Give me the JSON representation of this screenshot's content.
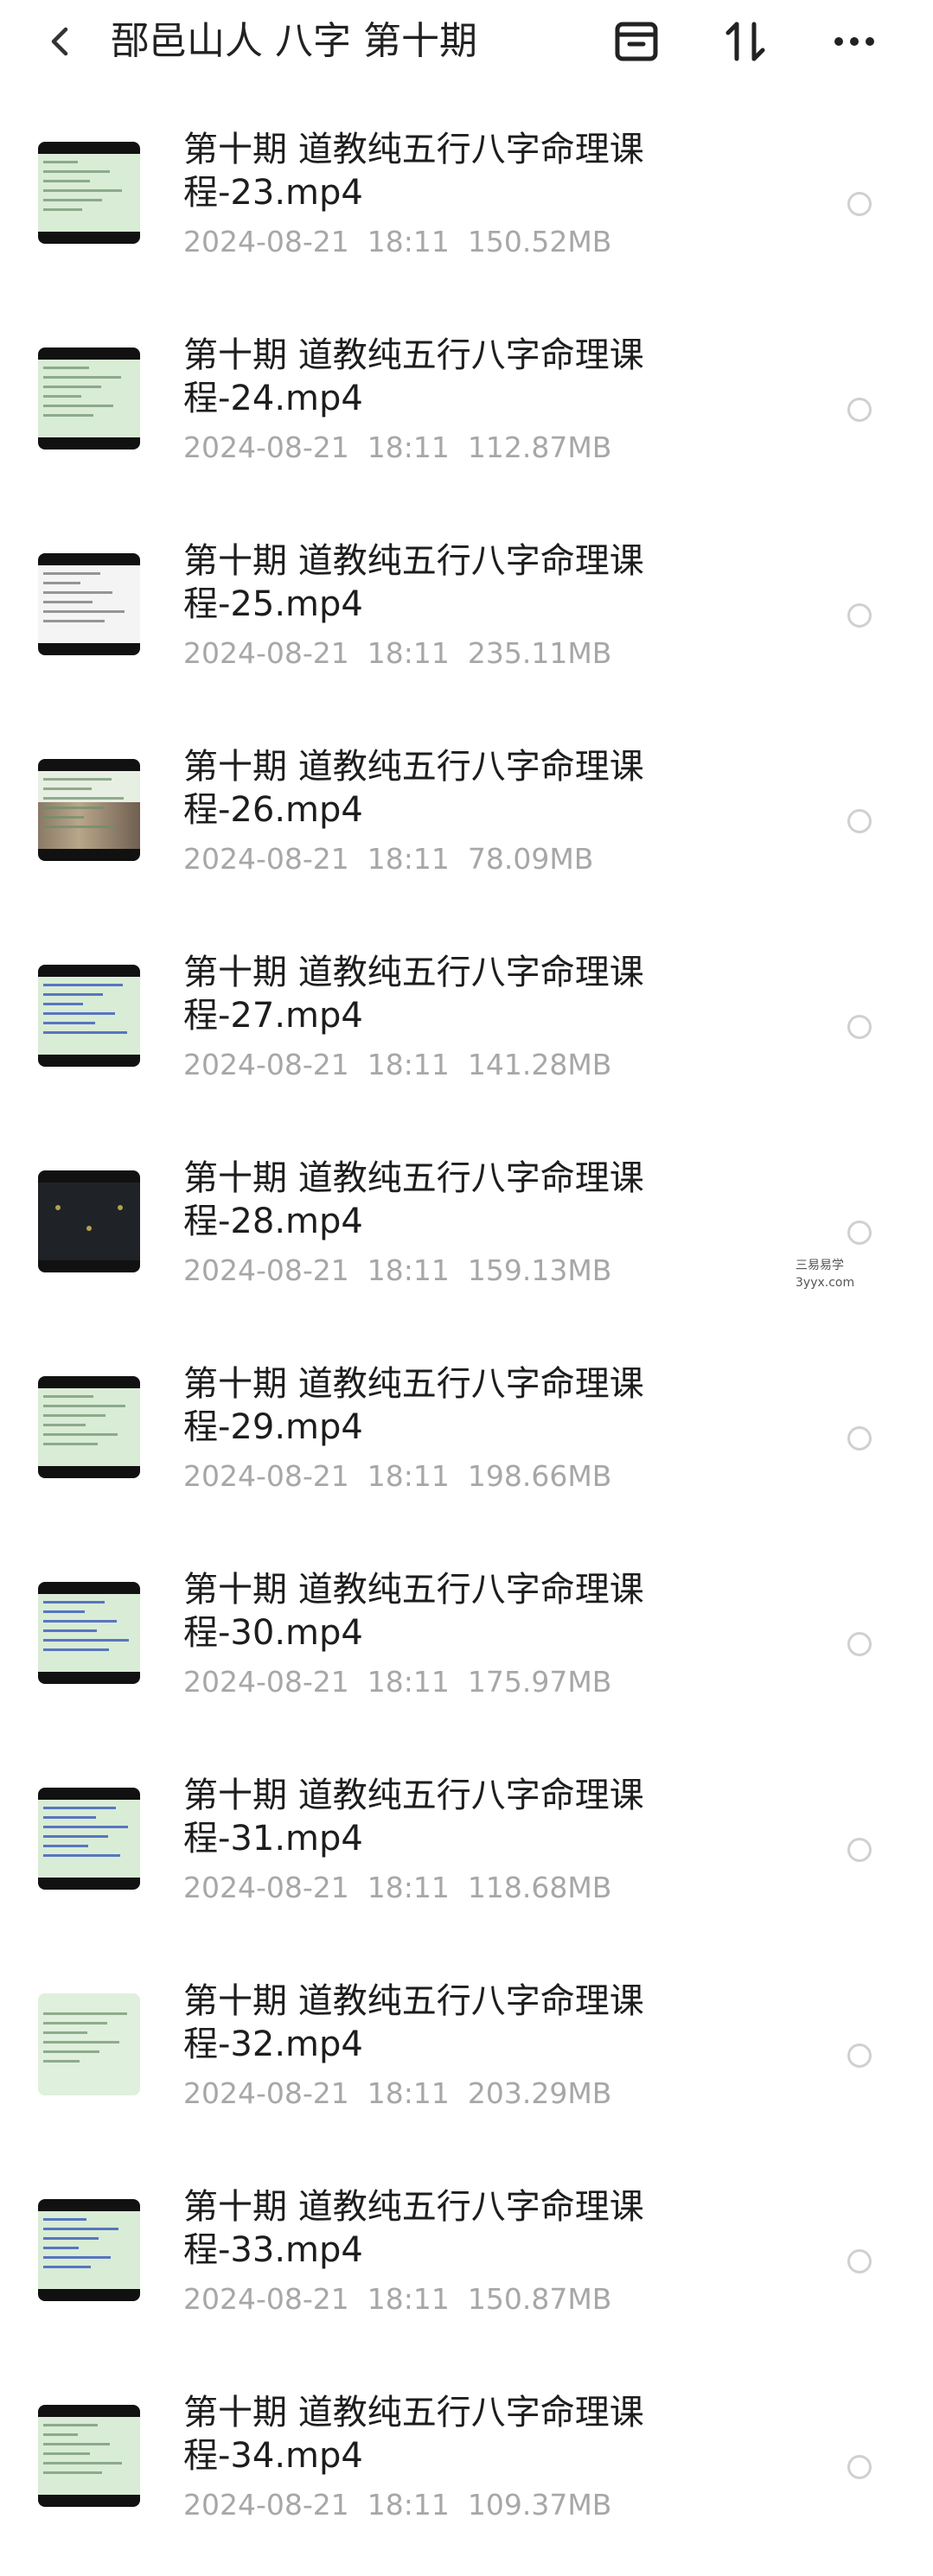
{
  "header": {
    "title": "郚邑山人 八字 第十期",
    "back_icon": "chevron-left-icon",
    "archive_icon": "archive-box-icon",
    "sort_icon": "sort-arrows-icon",
    "more_icon": "more-dots-icon"
  },
  "files": [
    {
      "name": "第十期 道教纯五行八字命理课程-23.mp4",
      "date": "2024-08-21",
      "time": "18:11",
      "size": "150.52MB",
      "thumb": "green"
    },
    {
      "name": "第十期 道教纯五行八字命理课程-24.mp4",
      "date": "2024-08-21",
      "time": "18:11",
      "size": "112.87MB",
      "thumb": "green"
    },
    {
      "name": "第十期 道教纯五行八字命理课程-25.mp4",
      "date": "2024-08-21",
      "time": "18:11",
      "size": "235.11MB",
      "thumb": "table"
    },
    {
      "name": "第十期 道教纯五行八字命理课程-26.mp4",
      "date": "2024-08-21",
      "time": "18:11",
      "size": "78.09MB",
      "thumb": "photo"
    },
    {
      "name": "第十期 道教纯五行八字命理课程-27.mp4",
      "date": "2024-08-21",
      "time": "18:11",
      "size": "141.28MB",
      "thumb": "blue"
    },
    {
      "name": "第十期 道教纯五行八字命理课程-28.mp4",
      "date": "2024-08-21",
      "time": "18:11",
      "size": "159.13MB",
      "thumb": "dark"
    },
    {
      "name": "第十期 道教纯五行八字命理课程-29.mp4",
      "date": "2024-08-21",
      "time": "18:11",
      "size": "198.66MB",
      "thumb": "green"
    },
    {
      "name": "第十期 道教纯五行八字命理课程-30.mp4",
      "date": "2024-08-21",
      "time": "18:11",
      "size": "175.97MB",
      "thumb": "blue"
    },
    {
      "name": "第十期 道教纯五行八字命理课程-31.mp4",
      "date": "2024-08-21",
      "time": "18:11",
      "size": "118.68MB",
      "thumb": "blue"
    },
    {
      "name": "第十期 道教纯五行八字命理课程-32.mp4",
      "date": "2024-08-21",
      "time": "18:11",
      "size": "203.29MB",
      "thumb": "pale"
    },
    {
      "name": "第十期 道教纯五行八字命理课程-33.mp4",
      "date": "2024-08-21",
      "time": "18:11",
      "size": "150.87MB",
      "thumb": "blue"
    },
    {
      "name": "第十期 道教纯五行八字命理课程-34.mp4",
      "date": "2024-08-21",
      "time": "18:11",
      "size": "109.37MB",
      "thumb": "green"
    }
  ],
  "watermark": {
    "line1": "三易易学",
    "line2": "3yyx.com"
  },
  "colors": {
    "meta_text": "#a7a7a7",
    "title_text": "#222222",
    "radio_border": "#d0d0d0"
  }
}
